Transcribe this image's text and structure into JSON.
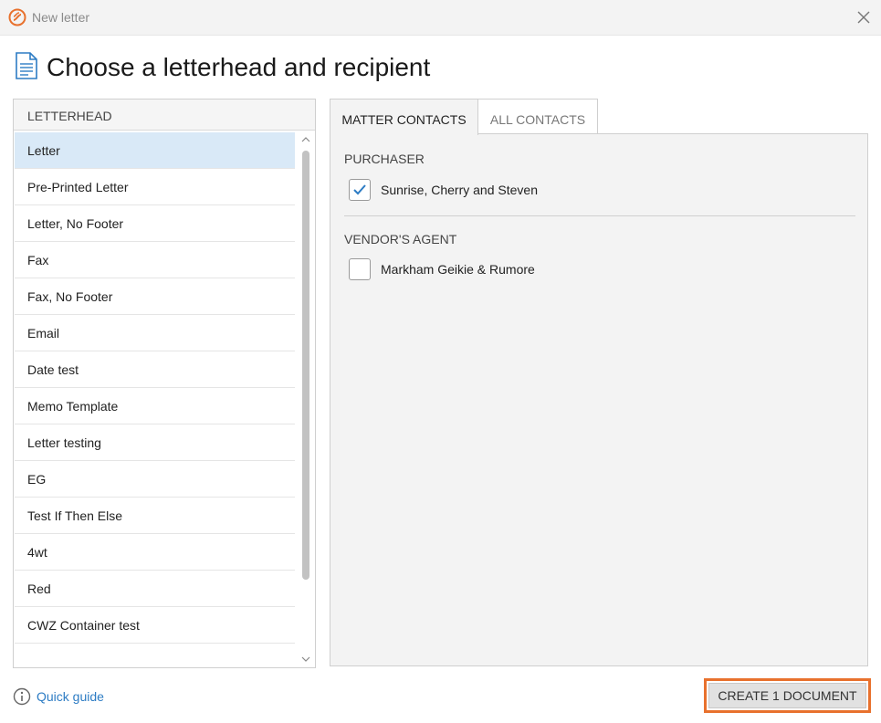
{
  "window": {
    "title": "New letter"
  },
  "page_title": "Choose a letterhead and recipient",
  "letterhead": {
    "header": "LETTERHEAD",
    "items": [
      {
        "label": "Letter",
        "selected": true
      },
      {
        "label": "Pre-Printed Letter"
      },
      {
        "label": "Letter, No Footer"
      },
      {
        "label": "Fax"
      },
      {
        "label": "Fax, No Footer"
      },
      {
        "label": "Email"
      },
      {
        "label": "Date test"
      },
      {
        "label": "Memo Template"
      },
      {
        "label": "Letter testing"
      },
      {
        "label": "EG"
      },
      {
        "label": "Test If Then Else"
      },
      {
        "label": "4wt"
      },
      {
        "label": "Red"
      },
      {
        "label": "CWZ Container test"
      }
    ]
  },
  "contacts": {
    "tabs": [
      {
        "label": "MATTER CONTACTS",
        "active": true
      },
      {
        "label": "ALL CONTACTS",
        "active": false
      }
    ],
    "groups": [
      {
        "label": "PURCHASER",
        "contacts": [
          {
            "name": "Sunrise, Cherry and Steven",
            "checked": true
          }
        ]
      },
      {
        "label": "VENDOR'S AGENT",
        "contacts": [
          {
            "name": "Markham Geikie & Rumore",
            "checked": false
          }
        ]
      }
    ]
  },
  "footer": {
    "quick_guide": "Quick guide",
    "create_button": "CREATE 1 DOCUMENT"
  },
  "colors": {
    "accent": "#e8712d",
    "link": "#2d7cc4",
    "selected_row": "#d9e9f7",
    "checkmark": "#2d7cc4"
  }
}
